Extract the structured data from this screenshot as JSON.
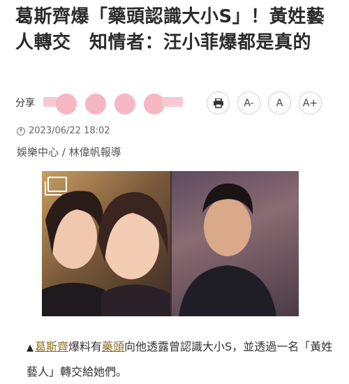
{
  "headline": "葛斯齊爆「藥頭認識大小S」！黃姓藝人轉交　知情者：汪小菲爆都是真的",
  "share": {
    "label": "分享"
  },
  "toolbar": {
    "print_icon": "print-icon",
    "font_decrease_label": "A-",
    "font_reset_label": "A",
    "font_increase_label": "A+"
  },
  "meta": {
    "datetime": "2023/06/22 18:02",
    "author": "娛樂中心 / 林偉帆報導"
  },
  "photo": {
    "gallery_icon": "gallery-icon"
  },
  "caption": {
    "arrow": "▲",
    "part1_link": "葛斯齊",
    "part2": "爆料有",
    "part3_link": "藥頭",
    "part4": "向他透露曾認識大小S，並透過一名「黃姓藝人」轉交給她們。"
  },
  "colors": {
    "share_pink": "#f6b6c3",
    "link_gold": "#8b6d21"
  }
}
